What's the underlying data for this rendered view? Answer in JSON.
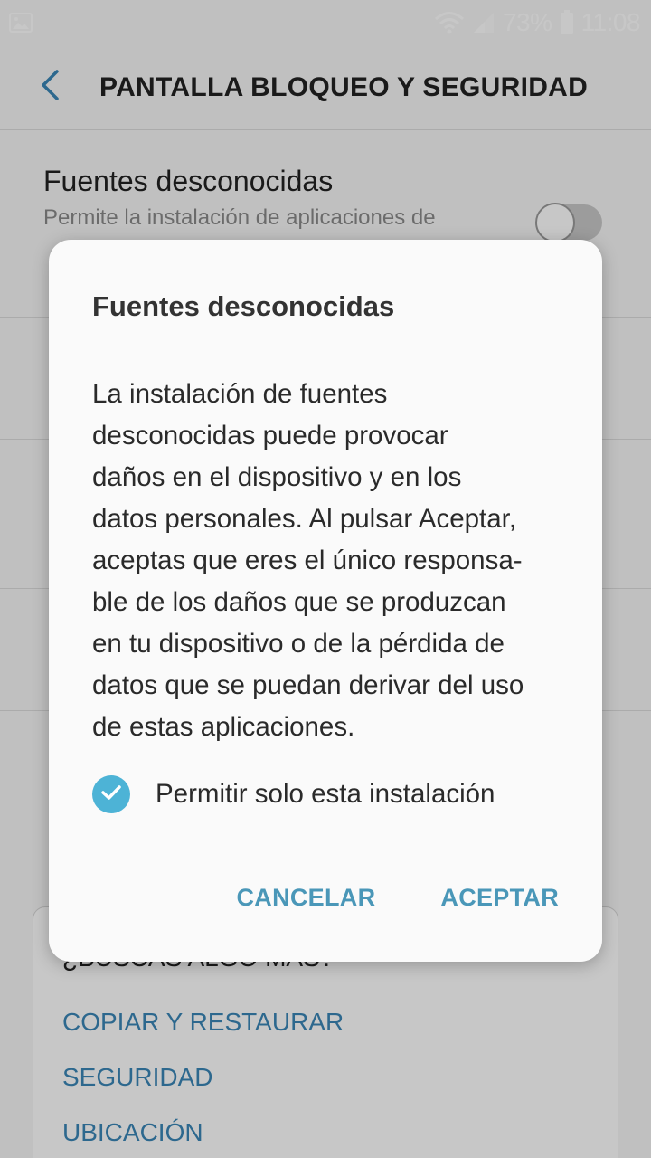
{
  "status_bar": {
    "battery_percent": "73%",
    "time": "11:08",
    "icons": [
      "image-icon",
      "wifi-icon",
      "signal-icon",
      "battery-icon"
    ]
  },
  "header": {
    "title": "PANTALLA BLOQUEO Y SEGURIDAD",
    "back_icon": "chevron-left-icon"
  },
  "settings": [
    {
      "title": "Fuentes desconocidas",
      "summary": "Permite la instalación de aplicaciones de",
      "toggle_on": false
    }
  ],
  "looking_box": {
    "title": "¿BUSCAS ALGO MÁS?",
    "links": [
      "COPIAR Y RESTAURAR",
      "SEGURIDAD",
      "UBICACIÓN"
    ]
  },
  "dialog": {
    "title": "Fuentes desconocidas",
    "body_lines": [
      "La instalación de fuentes",
      "desconocidas puede provocar",
      "daños en el dispositivo y en los",
      "datos personales. Al pulsar Aceptar,",
      "aceptas que eres el único responsa-",
      "ble de los daños que se produzcan",
      "en tu dispositivo o de la pérdida de",
      "datos que se puedan derivar del uso",
      "de estas aplicaciones."
    ],
    "checkbox_label": "Permitir solo esta instalación",
    "checkbox_checked": true,
    "cancel_label": "CANCELAR",
    "accept_label": "ACEPTAR"
  },
  "colors": {
    "accent": "#4db3d6",
    "button_text": "#4a97b8",
    "link": "#3a86b6"
  }
}
